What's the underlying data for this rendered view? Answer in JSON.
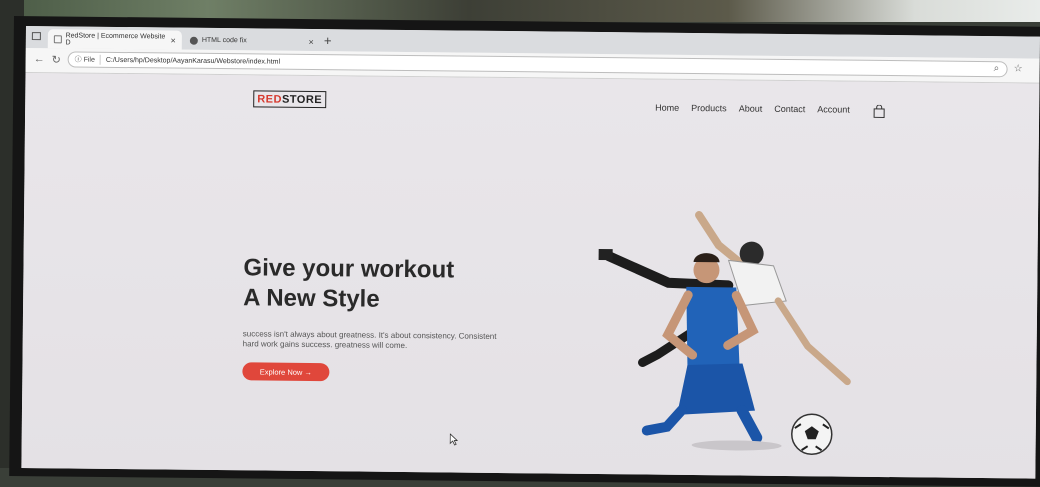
{
  "browser": {
    "tabs": [
      {
        "title": "RedStore | Ecommerce Website D",
        "active": true
      },
      {
        "title": "HTML code fix",
        "active": false
      }
    ],
    "new_tab_label": "+",
    "url_prefix": "File",
    "url": "C:/Users/hp/Desktop/AayanKarasu/Webstore/index.html"
  },
  "site": {
    "logo_red": "RED",
    "logo_dark": "STORE",
    "nav": [
      "Home",
      "Products",
      "About",
      "Contact",
      "Account"
    ],
    "hero": {
      "title_line1": "Give your workout",
      "title_line2": "A New Style",
      "text_line1": "success isn't always about greatness. It's about consistency. Consistent",
      "text_line2": "hard work gains success. greatness will come.",
      "button": "Explore Now →"
    }
  },
  "colors": {
    "accent": "#e0473b",
    "logo_red": "#d63a2f"
  },
  "icons": [
    "sidebar-icon",
    "page-icon",
    "globe-icon",
    "close-icon",
    "back-icon",
    "refresh-icon",
    "info-icon",
    "zoom-icon",
    "star-icon",
    "cart-icon"
  ]
}
